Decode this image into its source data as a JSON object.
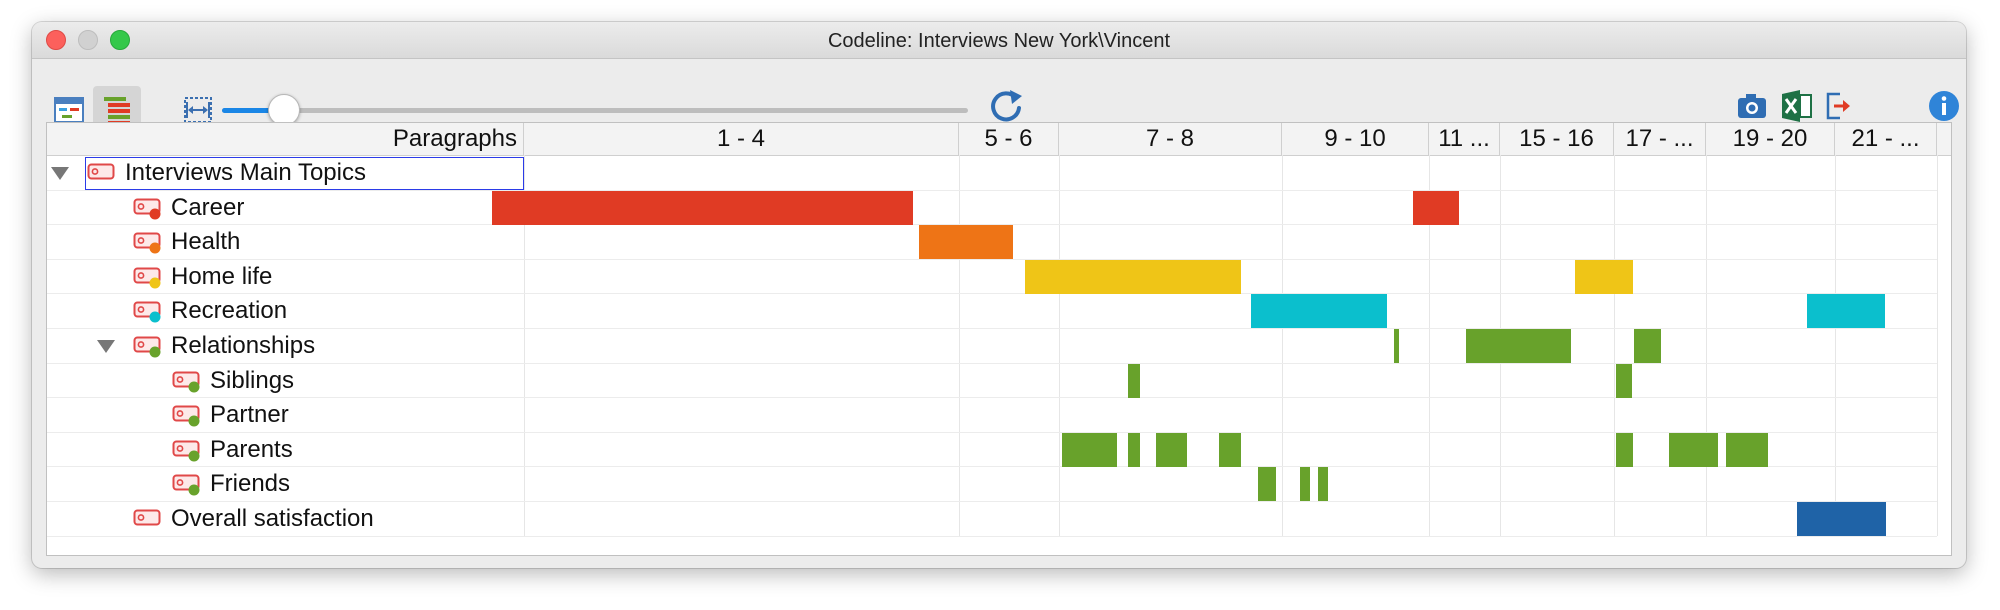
{
  "window": {
    "title": "Codeline: Interviews New York\\Vincent"
  },
  "toolbar": {
    "zoom_fraction": 0.082,
    "icons": [
      "overview-icon",
      "segment-view-icon",
      "fit-width-icon",
      "refresh-icon",
      "screenshot-icon",
      "excel-export-icon",
      "export-icon",
      "info-icon"
    ]
  },
  "table": {
    "corner_header": "Paragraphs",
    "columns": [
      "1 - 4",
      "5 - 6",
      "7 - 8",
      "9 - 10",
      "11 ...",
      "15 - 16",
      "17 - ...",
      "19 - 20",
      "21 - ..."
    ],
    "rows": [
      {
        "label": "Interviews Main Topics",
        "level": 0,
        "expanded": true,
        "dot": ""
      },
      {
        "label": "Career",
        "level": 1,
        "dot": "#e03b24"
      },
      {
        "label": "Health",
        "level": 1,
        "dot": "#ee7416"
      },
      {
        "label": "Home life",
        "level": 1,
        "dot": "#efc517"
      },
      {
        "label": "Recreation",
        "level": 1,
        "dot": "#0bbfcd"
      },
      {
        "label": "Relationships",
        "level": 1,
        "expanded": true,
        "dot": "#68a22b"
      },
      {
        "label": "Siblings",
        "level": 2,
        "dot": "#68a22b"
      },
      {
        "label": "Partner",
        "level": 2,
        "dot": "#68a22b"
      },
      {
        "label": "Parents",
        "level": 2,
        "dot": "#68a22b"
      },
      {
        "label": "Friends",
        "level": 2,
        "dot": "#68a22b"
      },
      {
        "label": "Overall satisfaction",
        "level": 1,
        "dot": ""
      }
    ]
  },
  "colors": {
    "career": "#e03b24",
    "health": "#ee7416",
    "home_life": "#efc517",
    "recreation": "#0bbfcd",
    "relationships": "#68a22b",
    "overall": "#1f63a7"
  }
}
